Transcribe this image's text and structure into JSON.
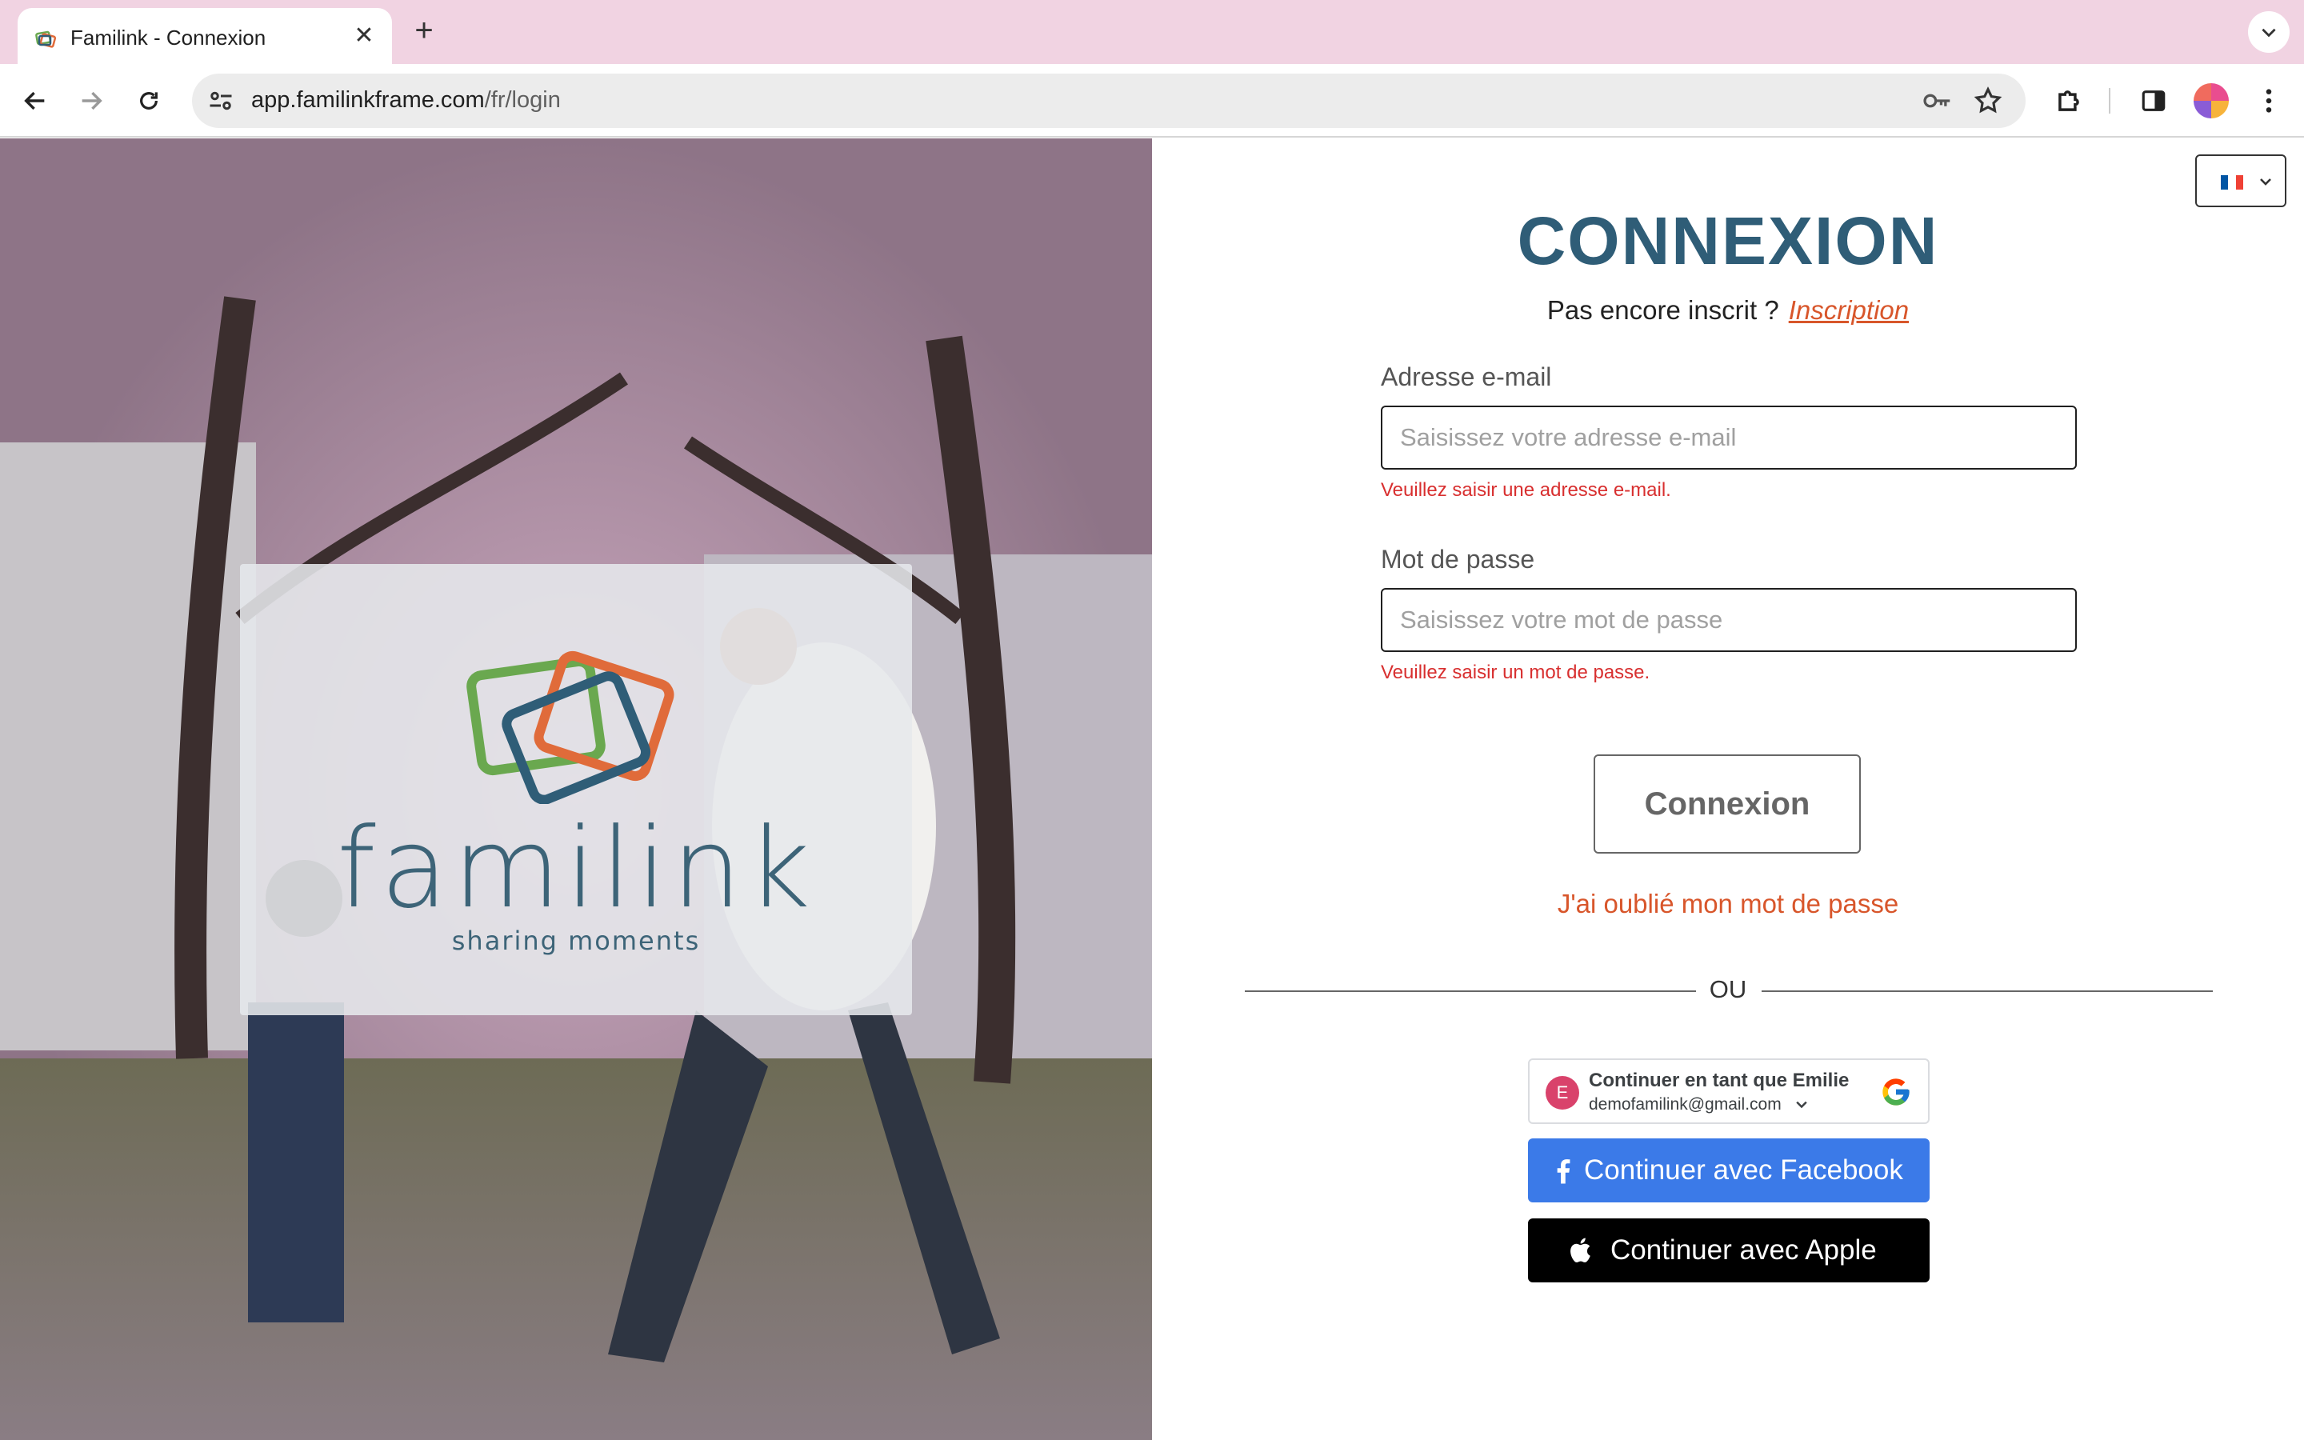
{
  "browser": {
    "tab_title": "Familink - Connexion",
    "url_host": "app.familinkframe.com",
    "url_path": "/fr/login"
  },
  "language": {
    "selected": "fr",
    "flag_colors": [
      "#0055a4",
      "#ffffff",
      "#ef4135"
    ]
  },
  "hero": {
    "brand": "familink",
    "tagline": "sharing moments"
  },
  "login": {
    "heading": "CONNEXION",
    "signup_prompt": "Pas encore inscrit ?",
    "signup_link": "Inscription",
    "email_label": "Adresse e-mail",
    "email_placeholder": "Saisissez votre adresse e-mail",
    "email_value": "",
    "email_error": "Veuillez saisir une adresse e-mail.",
    "password_label": "Mot de passe",
    "password_placeholder": "Saisissez votre mot de passe",
    "password_value": "",
    "password_error": "Veuillez saisir un mot de passe.",
    "submit_label": "Connexion",
    "forgot_label": "J'ai oublié mon mot de passe",
    "or_label": "OU"
  },
  "social": {
    "google_name": "Continuer en tant que Emilie",
    "google_email": "demofamilink@gmail.com",
    "google_avatar_letter": "E",
    "facebook_label": "Continuer avec Facebook",
    "apple_label": "Continuer avec Apple"
  },
  "colors": {
    "brand_blue": "#2f5d77",
    "accent_orange": "#d8562b",
    "error_red": "#d82f2f",
    "facebook_blue": "#3b7ae8",
    "tab_bar_pink": "#f1d3e2"
  }
}
